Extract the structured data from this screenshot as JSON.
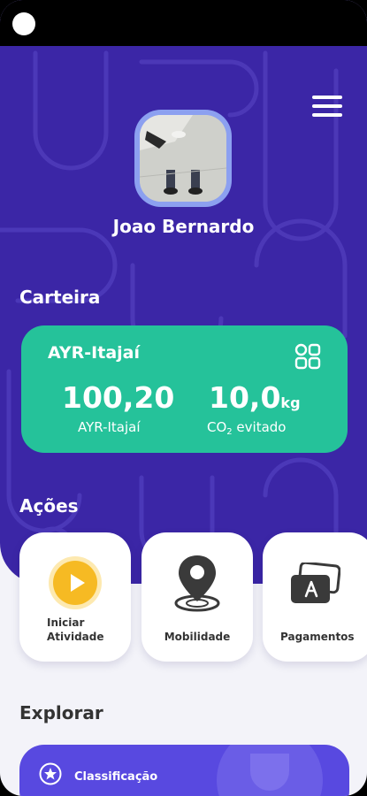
{
  "profile": {
    "name": "Joao Bernardo"
  },
  "wallet": {
    "section_title": "Carteira",
    "token_name": "AYR-Itajaí",
    "balance_value": "100,20",
    "balance_label": "AYR-Itajaí",
    "co2_value": "10,0",
    "co2_unit": "kg",
    "co2_label_prefix": "CO",
    "co2_label_sub": "2",
    "co2_label_suffix": " evitado"
  },
  "actions": {
    "section_title": "Ações",
    "items": [
      {
        "label_line1": "Iniciar",
        "label_line2": "Atividade"
      },
      {
        "label": "Mobilidade"
      },
      {
        "label": "Pagamentos"
      }
    ]
  },
  "explore": {
    "section_title": "Explorar",
    "items": [
      {
        "label": "Classificação"
      }
    ]
  },
  "colors": {
    "hero_background": "#3b26a6",
    "wallet_card": "#25c29a",
    "play_button": "#f6ba23",
    "explore_card": "#5849e0"
  },
  "icons": [
    "hamburger-menu-icon",
    "apps-grid-icon",
    "play-icon",
    "location-pin-icon",
    "cards-icon",
    "star-icon",
    "trophy-icon"
  ]
}
